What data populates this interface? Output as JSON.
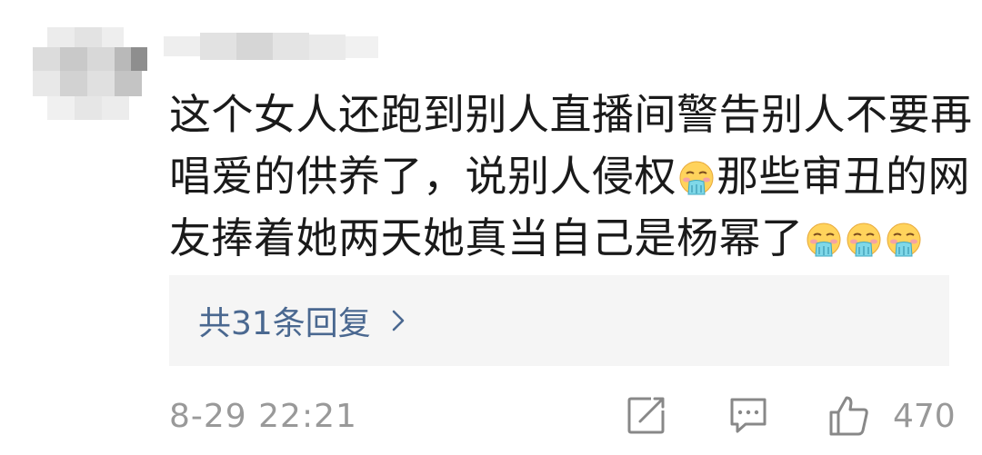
{
  "comment": {
    "lines": [
      "这个女人还跑到别人直播间警告别人不要再",
      "唱爱的供养了，说别人侵权",
      "那些审丑的网",
      "友捧着她两天她真当自己是杨幂了"
    ],
    "emoji": "vomiting-face-icon"
  },
  "replies": {
    "label": "共31条回复"
  },
  "footer": {
    "timestamp": "8-29 22:21",
    "like_count": "470"
  },
  "colors": {
    "text": "#1a1a1a",
    "link": "#4a6890",
    "meta": "#999999",
    "reply_bg": "#f5f5f5"
  }
}
